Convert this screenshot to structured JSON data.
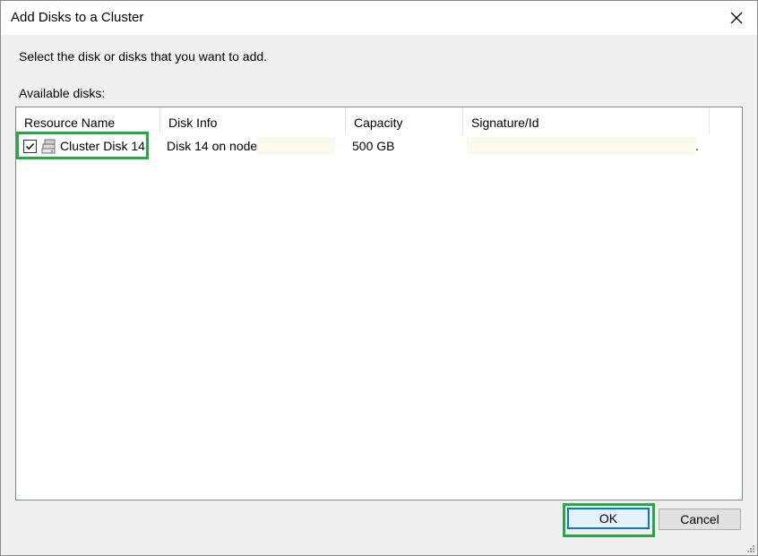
{
  "window": {
    "title": "Add Disks to a Cluster",
    "close_icon": "close-icon"
  },
  "instruction": "Select the disk or disks that you want to add.",
  "available_label": "Available disks:",
  "table": {
    "columns": [
      "Resource Name",
      "Disk Info",
      "Capacity",
      "Signature/Id"
    ],
    "rows": [
      {
        "checked": true,
        "icon": "disk-icon",
        "resource_name": "Cluster Disk 14",
        "disk_info": "Disk 14 on node",
        "capacity": "500 GB",
        "signature": "."
      }
    ]
  },
  "buttons": {
    "ok": "OK",
    "cancel": "Cancel"
  },
  "colors": {
    "highlight": "#22aa44",
    "default_button_border": "#0078d7",
    "redaction": "#fcfaee"
  }
}
